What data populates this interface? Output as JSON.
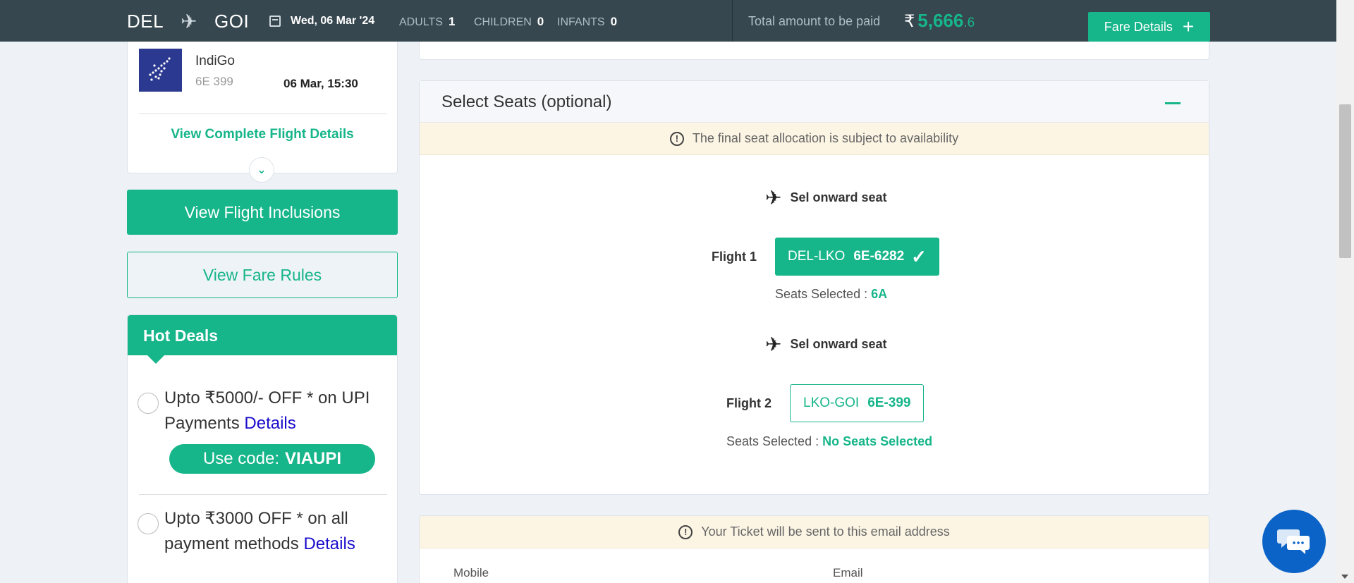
{
  "header": {
    "from": "DEL",
    "to": "GOI",
    "date": "Wed, 06 Mar '24",
    "adults_label": "ADULTS",
    "adults": "1",
    "children_label": "CHILDREN",
    "children": "0",
    "infants_label": "INFANTS",
    "infants": "0",
    "total_label": "Total amount to be paid",
    "currency": "₹",
    "total_int": "5,666",
    "total_dec": ".6",
    "fare_details_label": "Fare Details"
  },
  "flight_card": {
    "airline": "IndiGo",
    "flight_no": "6E 399",
    "time": "06 Mar, 15:30",
    "view_complete": "View Complete Flight Details"
  },
  "buttons": {
    "inclusions": "View Flight Inclusions",
    "fare_rules": "View Fare Rules"
  },
  "deals": {
    "title": "Hot Deals",
    "items": [
      {
        "text": "Upto ₹5000/- OFF * on UPI Payments",
        "details": "Details",
        "code_label": "Use code:",
        "code": "VIAUPI"
      },
      {
        "text": "Upto ₹3000 OFF * on all payment methods",
        "details": "Details"
      }
    ]
  },
  "seats": {
    "title": "Select Seats (optional)",
    "notice": "The final seat allocation is subject to availability",
    "segments": [
      {
        "heading": "Sel onward seat",
        "flight_label": "Flight 1",
        "route": "DEL-LKO",
        "number": "6E-6282",
        "selected_label": "Seats Selected :",
        "selected_value": "6A"
      },
      {
        "heading": "Sel onward seat",
        "flight_label": "Flight 2",
        "route": "LKO-GOI",
        "number": "6E-399",
        "selected_label": "Seats Selected :",
        "selected_value": "No Seats Selected"
      }
    ]
  },
  "contact": {
    "notice": "Your Ticket will be sent to this email address",
    "mobile_label": "Mobile",
    "email_label": "Email"
  },
  "colors": {
    "brand_green": "#16b58a",
    "header_bg": "#37474f",
    "notice_bg": "#fcf5e4",
    "chat_blue": "#0b63c7"
  }
}
